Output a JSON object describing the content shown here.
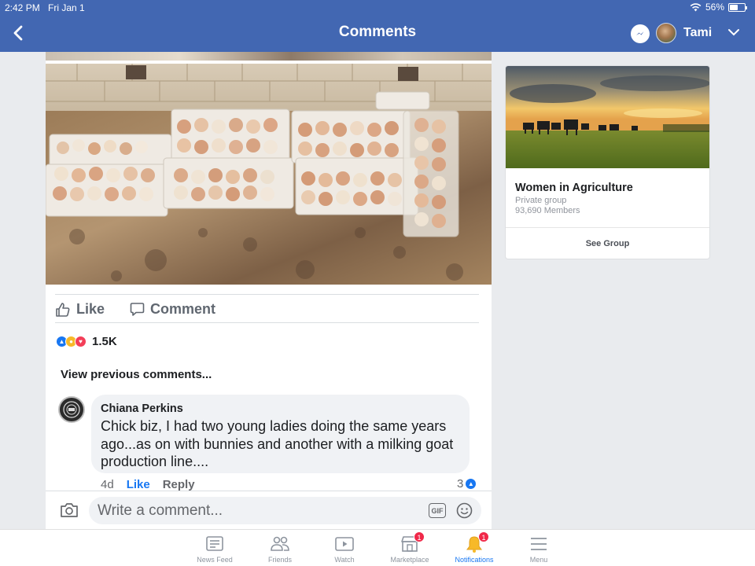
{
  "status_bar": {
    "time": "2:42 PM",
    "date": "Fri Jan 1",
    "battery": "56%",
    "battery_level": 0.56
  },
  "header": {
    "title": "Comments",
    "profile_name": "Tami"
  },
  "post": {
    "actions": {
      "like": "Like",
      "comment": "Comment"
    },
    "reaction_count": "1.5K",
    "reaction_types": [
      "like-icon",
      "haha-icon",
      "love-icon"
    ],
    "view_previous": "View previous comments..."
  },
  "comment": {
    "author": "Chiana Perkins",
    "text": "Chick biz, I had two young ladies doing the same years ago...as on with bunnies and another with a milking goat production line....",
    "time": "4d",
    "like_label": "Like",
    "reply_label": "Reply",
    "reaction_count": "3"
  },
  "write_comment": {
    "placeholder": "Write a comment...",
    "gif_label": "GIF"
  },
  "group_card": {
    "name": "Women in Agriculture",
    "privacy": "Private group",
    "members": "93,690 Members",
    "button": "See Group"
  },
  "tabbar": {
    "tabs": [
      {
        "label": "News Feed",
        "icon": "news-feed-icon",
        "badge": ""
      },
      {
        "label": "Friends",
        "icon": "friends-icon",
        "badge": ""
      },
      {
        "label": "Watch",
        "icon": "watch-icon",
        "badge": ""
      },
      {
        "label": "Marketplace",
        "icon": "marketplace-icon",
        "badge": "1"
      },
      {
        "label": "Notifications",
        "icon": "bell-icon",
        "badge": "1"
      },
      {
        "label": "Menu",
        "icon": "menu-icon",
        "badge": ""
      }
    ],
    "active": "Notifications"
  },
  "colors": {
    "header_bg": "#4267b2",
    "accent": "#1877f2",
    "badge": "#f02849"
  }
}
